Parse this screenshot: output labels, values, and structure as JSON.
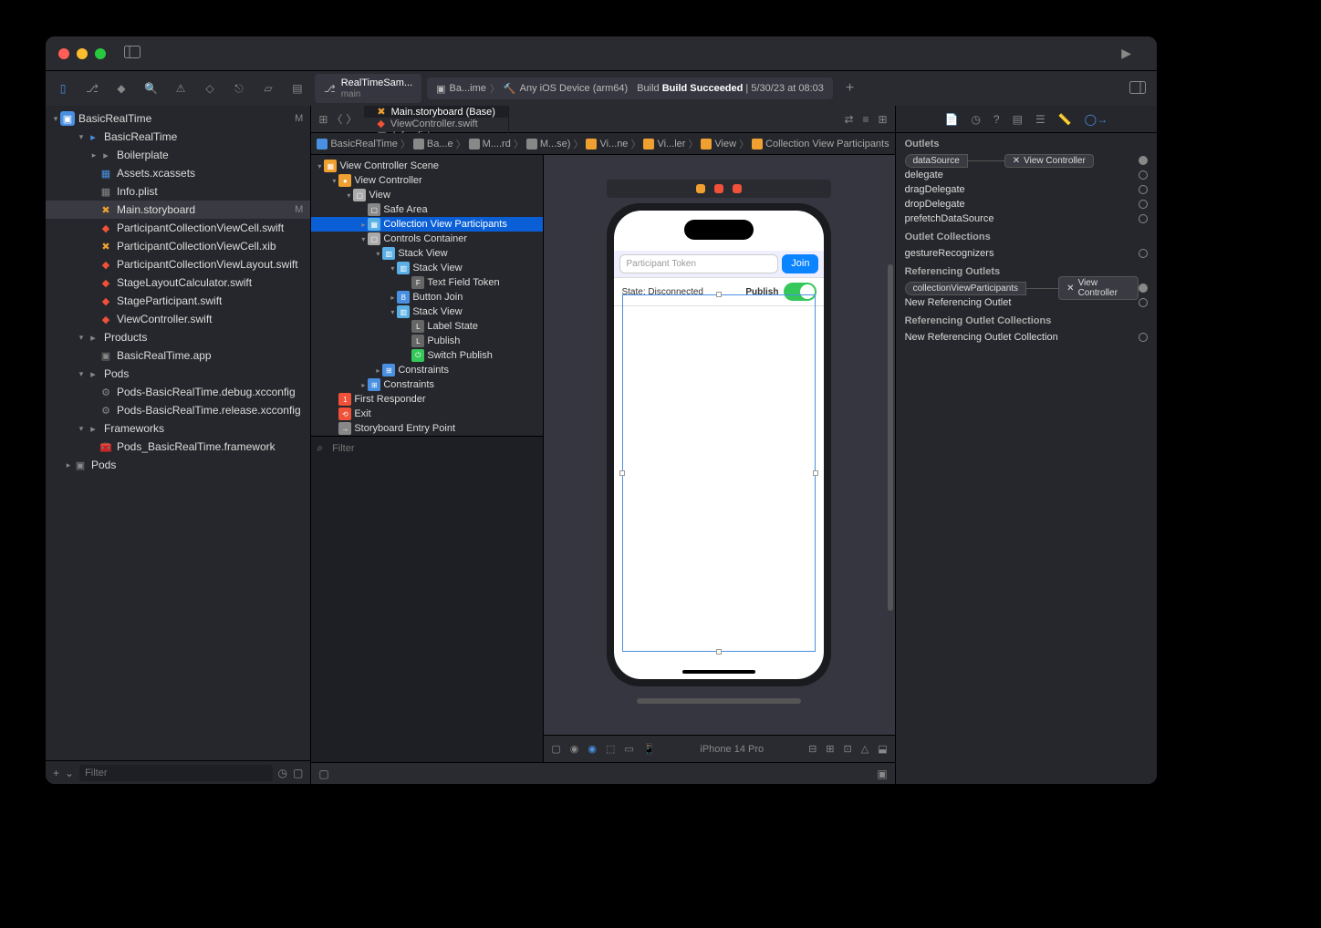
{
  "titlebar": {
    "scheme_name": "RealTimeSam...",
    "scheme_branch": "main",
    "scheme_target": "Ba...ime",
    "scheme_device": "Any iOS Device (arm64)",
    "build_status": "Build Succeeded",
    "build_time": "5/30/23 at 08:03"
  },
  "navigator": {
    "root": "BasicRealTime",
    "root_status": "M",
    "items": [
      {
        "indent": 1,
        "disclosure": "open",
        "icon": "folder-blue",
        "label": "BasicRealTime"
      },
      {
        "indent": 2,
        "disclosure": "closed",
        "icon": "folder",
        "label": "Boilerplate"
      },
      {
        "indent": 2,
        "icon": "assets",
        "label": "Assets.xcassets"
      },
      {
        "indent": 2,
        "icon": "plist",
        "label": "Info.plist"
      },
      {
        "indent": 2,
        "icon": "storyboard",
        "label": "Main.storyboard",
        "status": "M",
        "selected": true
      },
      {
        "indent": 2,
        "icon": "swift",
        "label": "ParticipantCollectionViewCell.swift"
      },
      {
        "indent": 2,
        "icon": "storyboard",
        "label": "ParticipantCollectionViewCell.xib"
      },
      {
        "indent": 2,
        "icon": "swift",
        "label": "ParticipantCollectionViewLayout.swift"
      },
      {
        "indent": 2,
        "icon": "swift",
        "label": "StageLayoutCalculator.swift"
      },
      {
        "indent": 2,
        "icon": "swift",
        "label": "StageParticipant.swift"
      },
      {
        "indent": 2,
        "icon": "swift",
        "label": "ViewController.swift"
      },
      {
        "indent": 1,
        "disclosure": "open",
        "icon": "folder",
        "label": "Products"
      },
      {
        "indent": 2,
        "icon": "app",
        "label": "BasicRealTime.app"
      },
      {
        "indent": 1,
        "disclosure": "open",
        "icon": "folder",
        "label": "Pods"
      },
      {
        "indent": 2,
        "icon": "config",
        "label": "Pods-BasicRealTime.debug.xcconfig"
      },
      {
        "indent": 2,
        "icon": "config",
        "label": "Pods-BasicRealTime.release.xcconfig"
      },
      {
        "indent": 1,
        "disclosure": "open",
        "icon": "folder",
        "label": "Frameworks"
      },
      {
        "indent": 2,
        "icon": "framework",
        "label": "Pods_BasicRealTime.framework"
      },
      {
        "indent": 0,
        "disclosure": "closed",
        "icon": "proj-blue",
        "label": "Pods"
      }
    ],
    "filter_placeholder": "Filter"
  },
  "tabs": [
    {
      "icon": "storyboard",
      "label": "Main.storyboard (Base)",
      "active": true
    },
    {
      "icon": "swift",
      "label": "ViewController.swift"
    },
    {
      "icon": "plist",
      "label": "Info.plist",
      "italic": true
    }
  ],
  "jumpbar": [
    "BasicRealTime",
    "Ba...e",
    "M....rd",
    "M...se)",
    "Vi...ne",
    "Vi...ler",
    "View",
    "Collection View Participants"
  ],
  "outline": {
    "scene_label": "View Controller Scene",
    "items": [
      {
        "indent": 0,
        "disclosure": "open",
        "icon": "scene",
        "label": "View Controller Scene"
      },
      {
        "indent": 1,
        "disclosure": "open",
        "icon": "vc",
        "label": "View Controller"
      },
      {
        "indent": 2,
        "disclosure": "open",
        "icon": "view",
        "label": "View"
      },
      {
        "indent": 3,
        "icon": "safe",
        "label": "Safe Area"
      },
      {
        "indent": 3,
        "disclosure": "closed",
        "icon": "cv",
        "label": "Collection View Participants",
        "selected": true
      },
      {
        "indent": 3,
        "disclosure": "open",
        "icon": "view",
        "label": "Controls Container"
      },
      {
        "indent": 4,
        "disclosure": "open",
        "icon": "stack",
        "label": "Stack View"
      },
      {
        "indent": 5,
        "disclosure": "open",
        "icon": "stack",
        "label": "Stack View"
      },
      {
        "indent": 6,
        "icon": "textfield",
        "label": "Text Field Token"
      },
      {
        "indent": 5,
        "disclosure": "closed",
        "icon": "button",
        "label": "Button Join"
      },
      {
        "indent": 5,
        "disclosure": "open",
        "icon": "stack",
        "label": "Stack View"
      },
      {
        "indent": 6,
        "icon": "label",
        "label": "Label State"
      },
      {
        "indent": 6,
        "icon": "label",
        "label": "Publish"
      },
      {
        "indent": 6,
        "icon": "switch",
        "label": "Switch Publish"
      },
      {
        "indent": 4,
        "disclosure": "closed",
        "icon": "constraints",
        "label": "Constraints"
      },
      {
        "indent": 3,
        "disclosure": "closed",
        "icon": "constraints",
        "label": "Constraints"
      },
      {
        "indent": 1,
        "icon": "responder",
        "label": "First Responder"
      },
      {
        "indent": 1,
        "icon": "exit",
        "label": "Exit"
      },
      {
        "indent": 1,
        "icon": "entry",
        "label": "Storyboard Entry Point"
      }
    ],
    "filter_placeholder": "Filter"
  },
  "canvas": {
    "token_placeholder": "Participant Token",
    "join_label": "Join",
    "state_label": "State: Disconnected",
    "publish_label": "Publish",
    "device_name": "iPhone 14 Pro"
  },
  "inspector": {
    "sections": {
      "outlets": "Outlets",
      "outlet_collections": "Outlet Collections",
      "referencing_outlets": "Referencing Outlets",
      "referencing_collections": "Referencing Outlet Collections"
    },
    "outlets": [
      {
        "name": "dataSource",
        "connected": true,
        "dest": "View Controller"
      },
      {
        "name": "delegate"
      },
      {
        "name": "dragDelegate"
      },
      {
        "name": "dropDelegate"
      },
      {
        "name": "prefetchDataSource"
      }
    ],
    "outlet_collections": [
      {
        "name": "gestureRecognizers"
      }
    ],
    "referencing": [
      {
        "name": "collectionViewParticipants",
        "connected": true,
        "dest": "View Controller"
      },
      {
        "name": "New Referencing Outlet"
      }
    ],
    "referencing_collections": [
      {
        "name": "New Referencing Outlet Collection"
      }
    ]
  },
  "icon_colors": {
    "swift": "#f05138",
    "storyboard": "#f0a030",
    "folder": "#888",
    "folder_blue": "#4a90e2",
    "plist": "#888",
    "assets": "#4a90e2",
    "app": "#888",
    "config": "#888",
    "framework": "#e6c34b",
    "vc": "#f0a030",
    "view": "#aaa",
    "cv": "#5ab0e6",
    "stack": "#5ab0e6",
    "label": "#666",
    "button": "#4a90e2",
    "textfield": "#666",
    "switch": "#34c759",
    "responder": "#f05138",
    "exit": "#f05138",
    "entry": "#888",
    "constraints": "#4a90e2",
    "safe": "#888",
    "scene": "#f0a030"
  }
}
